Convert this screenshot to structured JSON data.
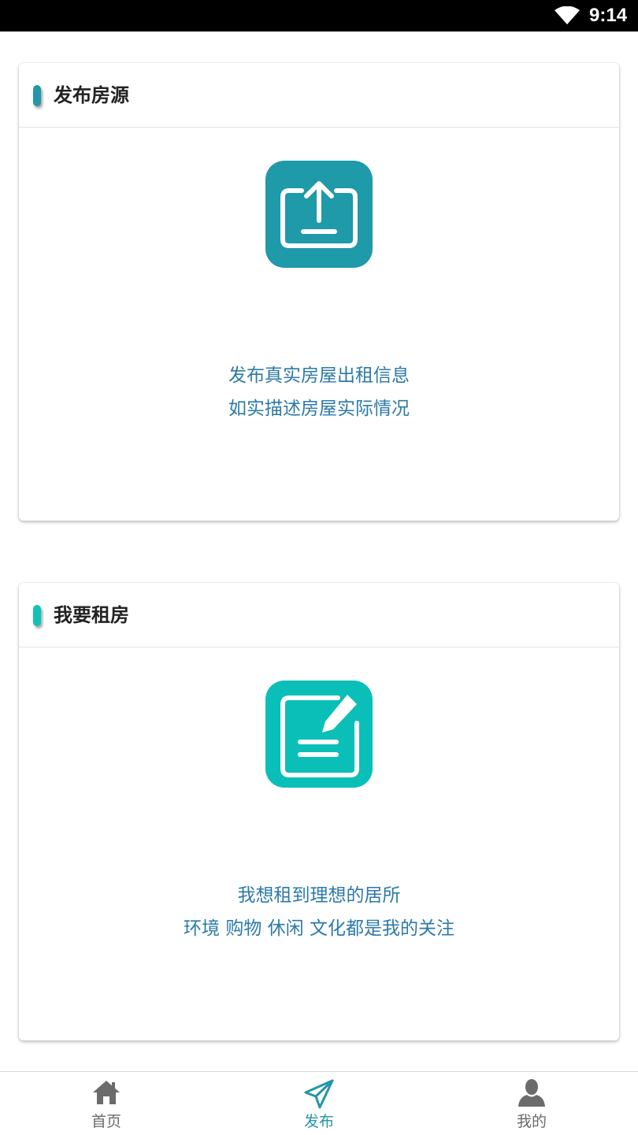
{
  "status_bar": {
    "time": "9:14",
    "wifi_icon": "wifi-icon"
  },
  "cards": [
    {
      "title": "发布房源",
      "accent_color": "#2596a8",
      "icon": "upload-icon",
      "icon_color": "#1e9aa9",
      "description_line1": "发布真实房屋出租信息",
      "description_line2": "如实描述房屋实际情况"
    },
    {
      "title": "我要租房",
      "accent_color": "#12c2b8",
      "icon": "edit-document-icon",
      "icon_color": "#0abfb8",
      "description_line1": "我想租到理想的居所",
      "description_line2": "环境 购物 休闲 文化都是我的关注"
    }
  ],
  "tab_bar": {
    "active_color": "#2596a8",
    "inactive_color": "#6b6b6b",
    "tabs": [
      {
        "label": "首页",
        "icon": "home-icon",
        "active": false
      },
      {
        "label": "发布",
        "icon": "paper-plane-icon",
        "active": true
      },
      {
        "label": "我的",
        "icon": "user-icon",
        "active": false
      }
    ]
  }
}
